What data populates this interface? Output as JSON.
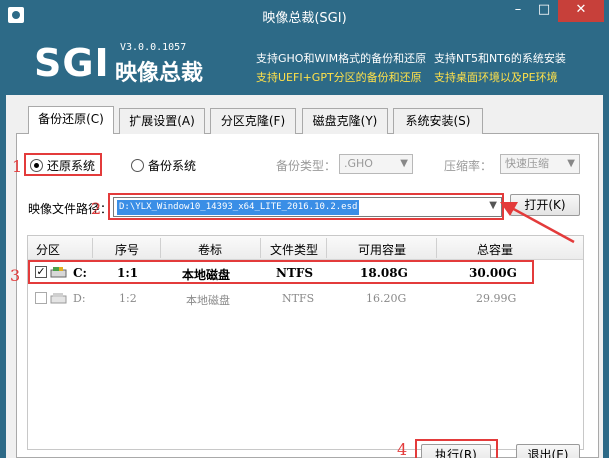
{
  "window": {
    "title": "映像总裁(SGI)",
    "min": "–",
    "max": "□",
    "close": "✕"
  },
  "banner": {
    "logo": "SGI",
    "app_name": "映像总裁",
    "version": "V3.0.0.1057",
    "features": [
      "支持GHO和WIM格式的备份和还原",
      "支持NT5和NT6的系统安装",
      "支持UEFI+GPT分区的备份和还原",
      "支持桌面环境以及PE环境"
    ]
  },
  "tabs": [
    "备份还原(C)",
    "扩展设置(A)",
    "分区克隆(F)",
    "磁盘克隆(Y)",
    "系统安装(S)"
  ],
  "options": {
    "restore": "还原系统",
    "backup": "备份系统",
    "backup_type_label": "备份类型：",
    "backup_type_value": ".GHO",
    "compression_label": "压缩率：",
    "compression_value": "快速压缩"
  },
  "image_path": {
    "label": "映像文件路径：",
    "value": "D:\\YLX_Window10_14393_x64_LITE_2016.10.2.esd",
    "open_button": "打开(K)"
  },
  "table": {
    "columns": [
      "分区",
      "序号",
      "卷标",
      "文件类型",
      "可用容量",
      "总容量"
    ],
    "rows": [
      {
        "checked": true,
        "partition": "C:",
        "index": "1:1",
        "label": "本地磁盘",
        "fs": "NTFS",
        "free": "18.08G",
        "total": "30.00G"
      },
      {
        "checked": false,
        "partition": "D:",
        "index": "1:2",
        "label": "本地磁盘",
        "fs": "NTFS",
        "free": "16.20G",
        "total": "29.99G"
      }
    ]
  },
  "footer": {
    "execute": "执行(R)",
    "exit": "退出(E)"
  },
  "annotations": [
    "1",
    "2",
    "3",
    "4"
  ],
  "colors": {
    "titlebar": "#2d6a87",
    "highlight": "#e33b3b",
    "feature_yellow": "#ffe14a"
  }
}
